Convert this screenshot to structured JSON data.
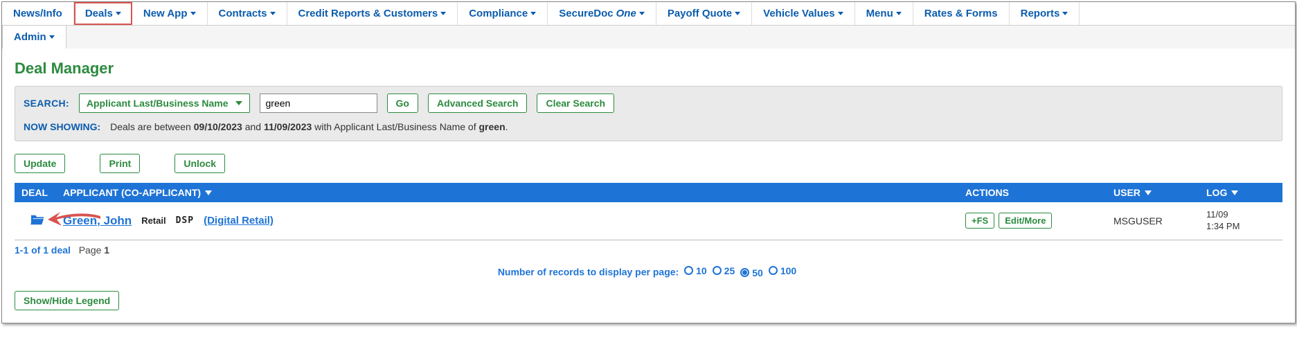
{
  "nav": {
    "items": [
      {
        "label": "News/Info",
        "caret": false
      },
      {
        "label": "Deals",
        "caret": true,
        "highlight": true
      },
      {
        "label": "New App",
        "caret": true
      },
      {
        "label": "Contracts",
        "caret": true
      },
      {
        "label": "Credit Reports & Customers",
        "caret": true
      },
      {
        "label": "Compliance",
        "caret": true
      },
      {
        "label_a": "SecureDoc",
        "label_b": "One",
        "caret": true,
        "special": true
      },
      {
        "label": "Payoff Quote",
        "caret": true
      },
      {
        "label": "Vehicle Values",
        "caret": true
      },
      {
        "label": "Menu",
        "caret": true
      },
      {
        "label": "Rates & Forms",
        "caret": false
      },
      {
        "label": "Reports",
        "caret": true
      }
    ],
    "row2": [
      {
        "label": "Admin",
        "caret": true
      }
    ]
  },
  "page_title": "Deal Manager",
  "search": {
    "label": "SEARCH:",
    "field_dropdown": "Applicant Last/Business Name",
    "input_value": "green",
    "go_label": "Go",
    "advanced_label": "Advanced Search",
    "clear_label": "Clear Search"
  },
  "now_showing": {
    "label": "NOW SHOWING:",
    "prefix": "Deals are between ",
    "date1": "09/10/2023",
    "mid1": " and ",
    "date2": "11/09/2023",
    "mid2": " with Applicant Last/Business Name of ",
    "term": "green",
    "suffix": "."
  },
  "actions": {
    "update": "Update",
    "print": "Print",
    "unlock": "Unlock"
  },
  "headers": {
    "deal": "DEAL",
    "applicant": "APPLICANT (CO-APPLICANT)",
    "actions": "ACTIONS",
    "user": "USER",
    "log": "LOG"
  },
  "rows": [
    {
      "name": "Green, John",
      "type": "Retail",
      "badge": "DSP",
      "channel": "(Digital Retail)",
      "action_fs": "+FS",
      "action_edit": "Edit/More",
      "user": "MSGUSER",
      "log_date": "11/09",
      "log_time": "1:34 PM"
    }
  ],
  "footer": {
    "count_text": "1-1 of 1 deal",
    "page_label": "Page",
    "page_num": "1",
    "records_label": "Number of records to display per page:",
    "options": [
      {
        "label": "10",
        "selected": false
      },
      {
        "label": "25",
        "selected": false
      },
      {
        "label": "50",
        "selected": true
      },
      {
        "label": "100",
        "selected": false
      }
    ],
    "legend": "Show/Hide Legend"
  }
}
